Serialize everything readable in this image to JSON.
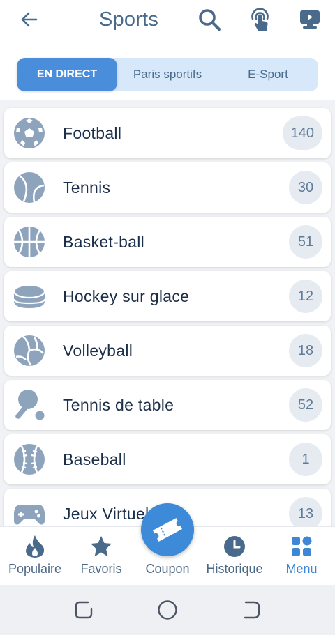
{
  "header": {
    "title": "Sports",
    "icons": [
      "back-arrow-icon",
      "search-icon",
      "touch-icon",
      "video-icon"
    ]
  },
  "tabs": [
    {
      "label": "EN DIRECT",
      "active": true
    },
    {
      "label": "Paris sportifs",
      "active": false
    },
    {
      "label": "E-Sport",
      "active": false
    }
  ],
  "sports": [
    {
      "name": "Football",
      "count": "140",
      "icon": "football-icon"
    },
    {
      "name": "Tennis",
      "count": "30",
      "icon": "tennis-icon"
    },
    {
      "name": "Basket-ball",
      "count": "51",
      "icon": "basketball-icon"
    },
    {
      "name": "Hockey sur glace",
      "count": "12",
      "icon": "hockey-puck-icon"
    },
    {
      "name": "Volleyball",
      "count": "18",
      "icon": "volleyball-icon"
    },
    {
      "name": "Tennis de table",
      "count": "52",
      "icon": "table-tennis-icon"
    },
    {
      "name": "Baseball",
      "count": "1",
      "icon": "baseball-icon"
    },
    {
      "name": "Jeux Virtuels",
      "count": "13",
      "icon": "gamepad-icon"
    }
  ],
  "bottom_nav": [
    {
      "label": "Populaire",
      "icon": "flame-icon",
      "active": false
    },
    {
      "label": "Favoris",
      "icon": "star-icon",
      "active": false
    },
    {
      "label": "Coupon",
      "icon": "ticket-icon",
      "active": false
    },
    {
      "label": "Historique",
      "icon": "clock-icon",
      "active": false
    },
    {
      "label": "Menu",
      "icon": "grid-icon",
      "active": true
    }
  ],
  "colors": {
    "accent": "#3d8ad9",
    "icon_gray": "#8ea4bd",
    "text_dark": "#1b2f4a",
    "header_text": "#4a6a8c"
  }
}
